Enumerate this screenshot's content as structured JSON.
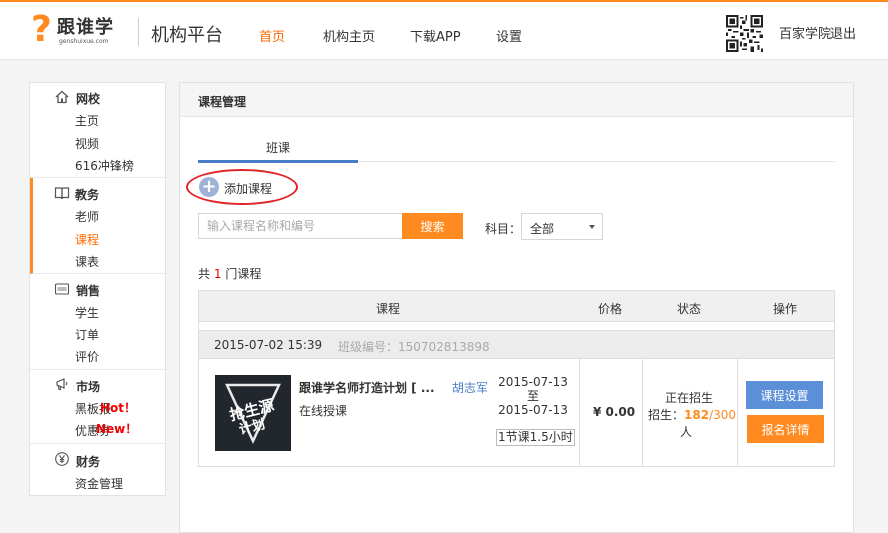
{
  "header": {
    "logo_mark": "?",
    "brand": "跟谁学",
    "domain": "genshuixue.com",
    "platform_title": "机构平台",
    "nav": [
      "首页",
      "机构主页",
      "下载APP",
      "设置"
    ],
    "user_name": "百家学院",
    "logout": "退出",
    "accent_color": "#ff8a1f",
    "active_color": "#ff6a00"
  },
  "sidebar": {
    "groups": [
      {
        "title": "网校",
        "icon": "home-icon",
        "items": [
          "主页",
          "视频",
          "616冲锋榜"
        ]
      },
      {
        "title": "教务",
        "icon": "book-icon",
        "items": [
          "老师",
          "课程",
          "课表"
        ],
        "active_item": "课程"
      },
      {
        "title": "销售",
        "icon": "sale-icon",
        "items": [
          "学生",
          "订单",
          "评价"
        ]
      },
      {
        "title": "市场",
        "icon": "megaphone-icon",
        "items": [
          "黑板报",
          "优惠券"
        ],
        "badges": [
          "Hot！",
          "New！"
        ]
      },
      {
        "title": "财务",
        "icon": "yen-icon",
        "items": [
          "资金管理"
        ]
      }
    ]
  },
  "main": {
    "panel_title": "课程管理",
    "tab": "班课",
    "add_course": "添加课程",
    "search_placeholder": "输入课程名称和编号",
    "search_button": "搜索",
    "subject_label": "科目：",
    "subject_value": "全部",
    "total_prefix": "共",
    "total_count": "1",
    "total_suffix": "门课程",
    "columns": [
      "课程",
      "价格",
      "状态",
      "操作"
    ],
    "group": {
      "datetime": "2015-07-02 15:39",
      "code": "班级编号：150702813898"
    },
    "course": {
      "thumb_text": "抢生源计划",
      "name": "跟谁学名师打造计划 [ ...",
      "teacher": "胡志军",
      "type": "在线授课",
      "date_start": "2015-07-13",
      "date_sep": "至",
      "date_end": "2015-07-13",
      "duration": "1节课1.5小时",
      "price": "¥ 0.00",
      "status": "正在招生",
      "enroll_label": "招生：",
      "enroll_current": "182",
      "enroll_sep": "/",
      "enroll_capacity": "300",
      "enroll_unit": "人",
      "btn_settings": "课程设置",
      "btn_enroll": "报名详情"
    }
  }
}
